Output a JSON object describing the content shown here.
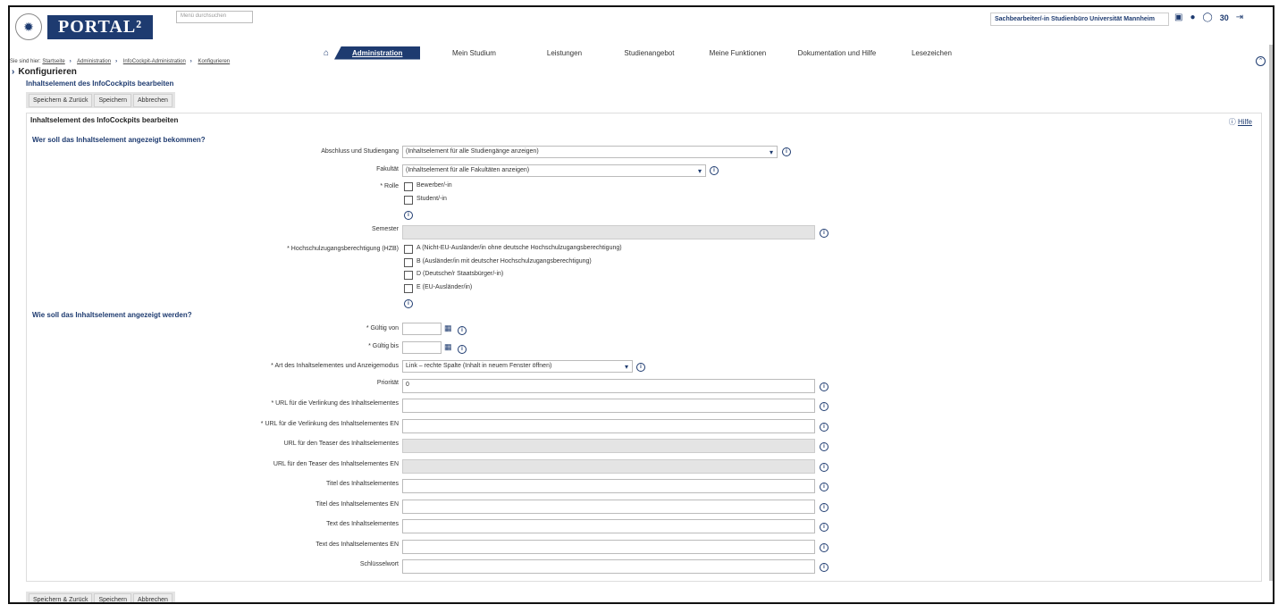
{
  "header": {
    "logo_text": "PORTAL²",
    "menu_search_placeholder": "Menü durchsuchen",
    "user_role": "Sachbearbeiter/-in Studienbüro Universität Mannheim",
    "session_minutes": "30"
  },
  "nav": {
    "items": [
      "Administration",
      "Mein Studium",
      "Leistungen",
      "Studienangebot",
      "Meine Funktionen",
      "Dokumentation und Hilfe",
      "Lesezeichen"
    ]
  },
  "breadcrumb": {
    "prefix": "Sie sind hier:",
    "items": [
      "Startseite",
      "Administration",
      "InfoCockpit-Administration",
      "Konfigurieren"
    ]
  },
  "page": {
    "title": "Konfigurieren",
    "subtitle": "Inhaltselement des InfoCockpits bearbeiten"
  },
  "buttons": {
    "save_back": "Speichern & Zurück",
    "save": "Speichern",
    "cancel": "Abbrechen"
  },
  "panel": {
    "title": "Inhaltselement des InfoCockpits bearbeiten",
    "help": "Hilfe"
  },
  "section1": {
    "title": "Wer soll das Inhaltselement angezeigt bekommen?",
    "degree_label": "Abschluss und Studiengang",
    "degree_value": "(Inhaltselement für alle Studiengänge anzeigen)",
    "faculty_label": "Fakultät",
    "faculty_value": "(Inhaltselement für alle Fakultäten anzeigen)",
    "role_label": "* Rolle",
    "roles": [
      "Bewerber/-in",
      "Student/-in"
    ],
    "semester_label": "Semester",
    "hzb_label": "* Hochschulzugangsberechtigung (HZB)",
    "hzb_options": [
      "A (Nicht-EU-Ausländer/in ohne deutsche Hochschulzugangsberechtigung)",
      "B (Ausländer/in mit deutscher Hochschulzugangsberechtigung)",
      "D (Deutsche/r Staatsbürger/-in)",
      "E (EU-Ausländer/in)"
    ]
  },
  "section2": {
    "title": "Wie soll das Inhaltselement angezeigt werden?",
    "valid_from_label": "* Gültig von",
    "valid_to_label": "* Gültig bis",
    "mode_label": "* Art des Inhaltselementes und Anzeigemodus",
    "mode_value": "Link – rechte Spalte (Inhalt in neuem Fenster öffnen)",
    "priority_label": "Priorität",
    "priority_value": "0",
    "url_label": "* URL für die Verlinkung des Inhaltselementes",
    "url_en_label": "* URL für die Verlinkung des Inhaltselementes EN",
    "teaser_label": "URL für den Teaser des Inhaltselementes",
    "teaser_en_label": "URL für den Teaser des Inhaltselementes EN",
    "title_label": "Titel des Inhaltselementes",
    "title_en_label": "Titel des Inhaltselementes EN",
    "text_label": "Text des Inhaltselementes",
    "text_en_label": "Text des Inhaltselementes EN",
    "keyword_label": "Schlüsselwort"
  },
  "icons": {
    "seal": "university-seal-icon",
    "home": "home-icon",
    "info": "info-icon",
    "calendar": "calendar-icon",
    "dropdown": "chevron-down-icon"
  },
  "colors": {
    "brand": "#1e3b70",
    "disabled_field": "#e4e4e4"
  }
}
